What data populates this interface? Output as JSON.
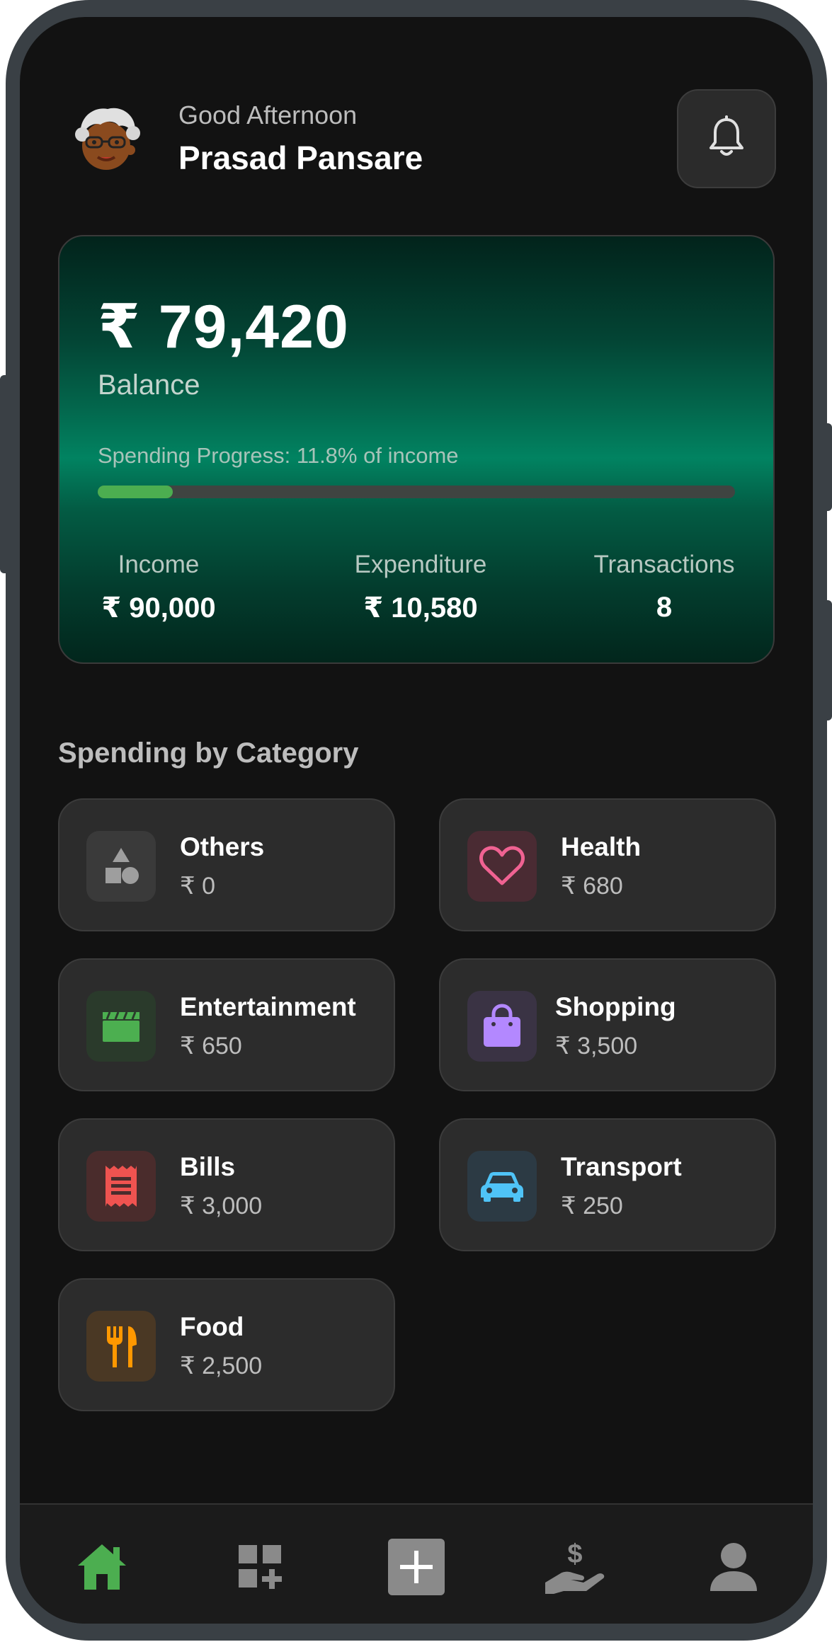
{
  "header": {
    "greeting": "Good Afternoon",
    "user_name": "Prasad Pansare"
  },
  "balance_card": {
    "balance": "₹ 79,420",
    "balance_label": "Balance",
    "progress_text": "Spending Progress: 11.8% of income",
    "progress_percent": 11.8,
    "stats": [
      {
        "label": "Income",
        "value": "₹ 90,000"
      },
      {
        "label": "Expenditure",
        "value": "₹ 10,580"
      },
      {
        "label": "Transactions",
        "value": "8"
      }
    ]
  },
  "categories": {
    "title": "Spending by Category",
    "items": [
      {
        "name": "Others",
        "amount": "₹ 0",
        "icon": "shapes-icon",
        "color": "#9e9e9e"
      },
      {
        "name": "Health",
        "amount": "₹ 680",
        "icon": "heart-icon",
        "color": "#f06292"
      },
      {
        "name": "Entertainment",
        "amount": "₹ 650",
        "icon": "clapperboard-icon",
        "color": "#4caf50"
      },
      {
        "name": "Shopping",
        "amount": "₹ 3,500",
        "icon": "shopping-bag-icon",
        "color": "#b388ff"
      },
      {
        "name": "Bills",
        "amount": "₹ 3,000",
        "icon": "receipt-icon",
        "color": "#ef5350"
      },
      {
        "name": "Transport",
        "amount": "₹ 250",
        "icon": "car-icon",
        "color": "#4fc3f7"
      },
      {
        "name": "Food",
        "amount": "₹ 2,500",
        "icon": "fork-knife-icon",
        "color": "#ff9800"
      }
    ]
  },
  "nav": {
    "items": [
      {
        "name": "home",
        "icon": "home-icon",
        "active": true
      },
      {
        "name": "categories",
        "icon": "dashboard-add-icon",
        "active": false
      },
      {
        "name": "add",
        "icon": "plus-icon",
        "active": false
      },
      {
        "name": "loans",
        "icon": "hand-dollar-icon",
        "active": false
      },
      {
        "name": "profile",
        "icon": "person-icon",
        "active": false
      }
    ]
  },
  "colors": {
    "accent": "#4cae50",
    "background": "#121212",
    "card": "#2c2c2c"
  }
}
